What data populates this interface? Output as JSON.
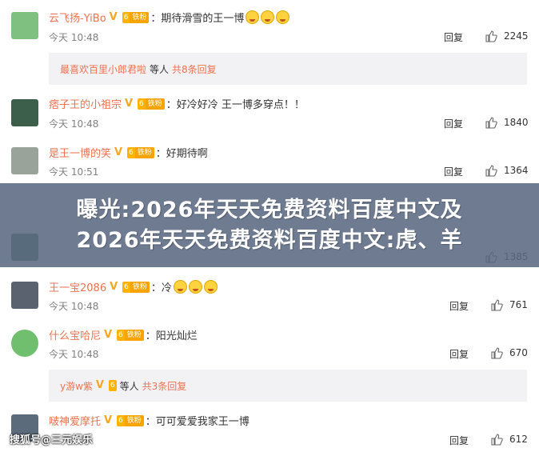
{
  "comments": [
    {
      "user": "云飞扬-YiBo",
      "fan_level": "6",
      "fan_label": "铁粉",
      "text": "期待滑雪的王一博",
      "time": "今天 10:48",
      "reply": "回复",
      "likes": "2245",
      "avatar_color": "#7fbf7f",
      "emoji_count": 3
    },
    {
      "user": "痞子王的小祖宗",
      "fan_level": "6",
      "fan_label": "铁粉",
      "text": "好冷好冷 王一博多穿点！！",
      "time": "今天 10:48",
      "reply": "回复",
      "likes": "1840",
      "avatar_color": "#3b5f4a"
    },
    {
      "user": "是王一博的笑",
      "fan_level": "6",
      "fan_label": "铁粉",
      "text": "好期待啊",
      "time": "今天 10:51",
      "reply": "回复",
      "likes": "1364",
      "avatar_color": "#9aa39a"
    },
    {
      "user": "",
      "fan_level": "",
      "fan_label": "",
      "text": "",
      "time": "",
      "reply": "",
      "likes": "1385",
      "avatar_color": "#4d7a5a"
    },
    {
      "user": "王一宝2086",
      "fan_level": "6",
      "fan_label": "铁粉",
      "text": "冷",
      "time": "今天 10:48",
      "reply": "回复",
      "likes": "761",
      "avatar_color": "#5a6270",
      "emoji_count": 3
    },
    {
      "user": "什么宝哈尼",
      "fan_level": "6",
      "fan_label": "铁粉",
      "text": "阳光灿烂",
      "time": "今天 10:48",
      "reply": "回复",
      "likes": "670",
      "avatar_color": "#6fbf6f"
    },
    {
      "user": "啵神爱摩托",
      "fan_level": "6",
      "fan_label": "铁粉",
      "text": "可可爱爱我家王一博",
      "time": "",
      "reply": "回复",
      "likes": "612",
      "avatar_color": "#5b6b7b"
    }
  ],
  "subreplies": [
    {
      "user": "最喜欢百里小郎君啦",
      "mid": "等人",
      "count": "共8条回复"
    },
    {
      "user": "y游w紫",
      "mid": "等人",
      "count": "共3条回复"
    }
  ],
  "overlay": {
    "line1": "曝光:2026年天天免费资料百度中文及",
    "line2": "2026年天天免费资料百度中文:虎、羊"
  },
  "watermark": "搜狐号@三元娱乐",
  "colors": {
    "username": "#eb7350",
    "muted": "#808080",
    "subreply_bg": "#f2f2f5",
    "overlay_bg": "#5a6982"
  }
}
